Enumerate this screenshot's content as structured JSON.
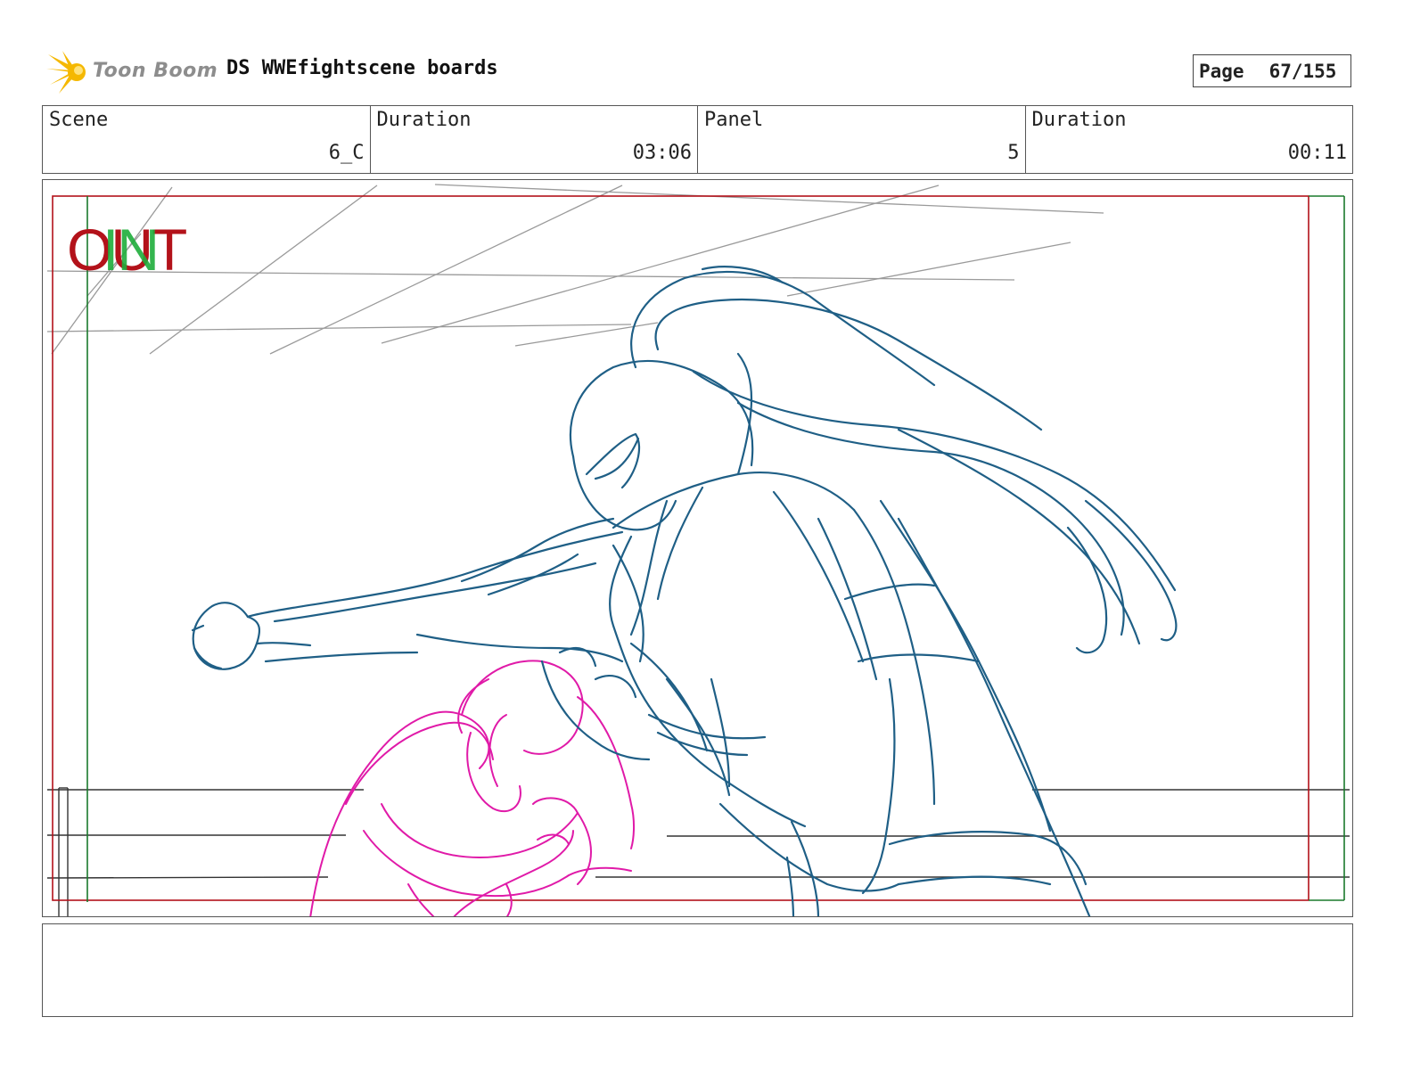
{
  "header": {
    "logo_text": "Toon Boom",
    "title": "DS WWEfightscene boards",
    "page_label": "Page",
    "page_number": "67/155"
  },
  "info": {
    "scene_label": "Scene",
    "scene_value": "6_C",
    "scene_duration_label": "Duration",
    "scene_duration_value": "03:06",
    "panel_label": "Panel",
    "panel_value": "5",
    "panel_duration_label": "Duration",
    "panel_duration_value": "00:11"
  },
  "panel_view": {
    "out_label": "OUT",
    "in_label": "IN",
    "out_frame_color": "#b3121a",
    "in_frame_color": "#1a7a2c",
    "sketch_color_main": "#1f5f86",
    "sketch_color_secondary": "#e01aa8"
  },
  "notes": {
    "text": ""
  }
}
